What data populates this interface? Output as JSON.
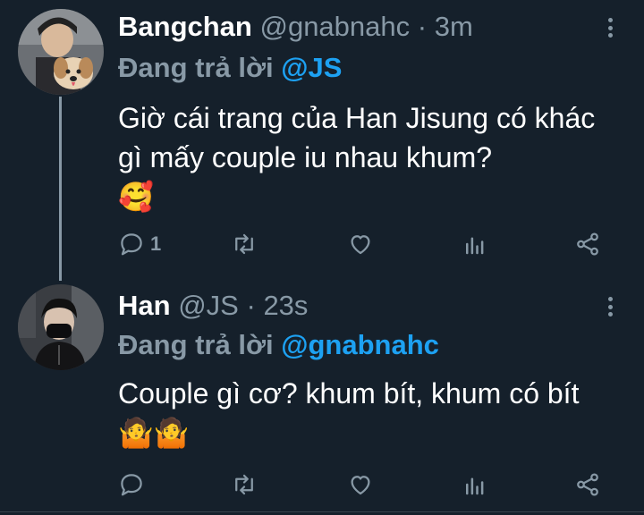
{
  "tweets": [
    {
      "name": "Bangchan",
      "handle": "@gnabnahc",
      "separator": "·",
      "time": "3m",
      "reply_prefix": "Đang trả lời",
      "reply_to": "@JS",
      "text": "Giờ cái trang của Han Jisung có khác gì mấy couple iu nhau khum?",
      "emoji": "🥰",
      "reply_count": "1",
      "avatar_icon": "person-with-dog-avatar"
    },
    {
      "name": "Han",
      "handle": "@JS",
      "separator": "·",
      "time": "23s",
      "reply_prefix": "Đang trả lời",
      "reply_to": "@gnabnahc",
      "text": "Couple gì cơ? khum bít, khum có bít",
      "emoji": "🤷🤷",
      "reply_count": "",
      "avatar_icon": "person-with-mask-avatar"
    }
  ],
  "colors": {
    "background": "#15202b",
    "accent": "#1da1f2",
    "muted": "#8899a6"
  }
}
